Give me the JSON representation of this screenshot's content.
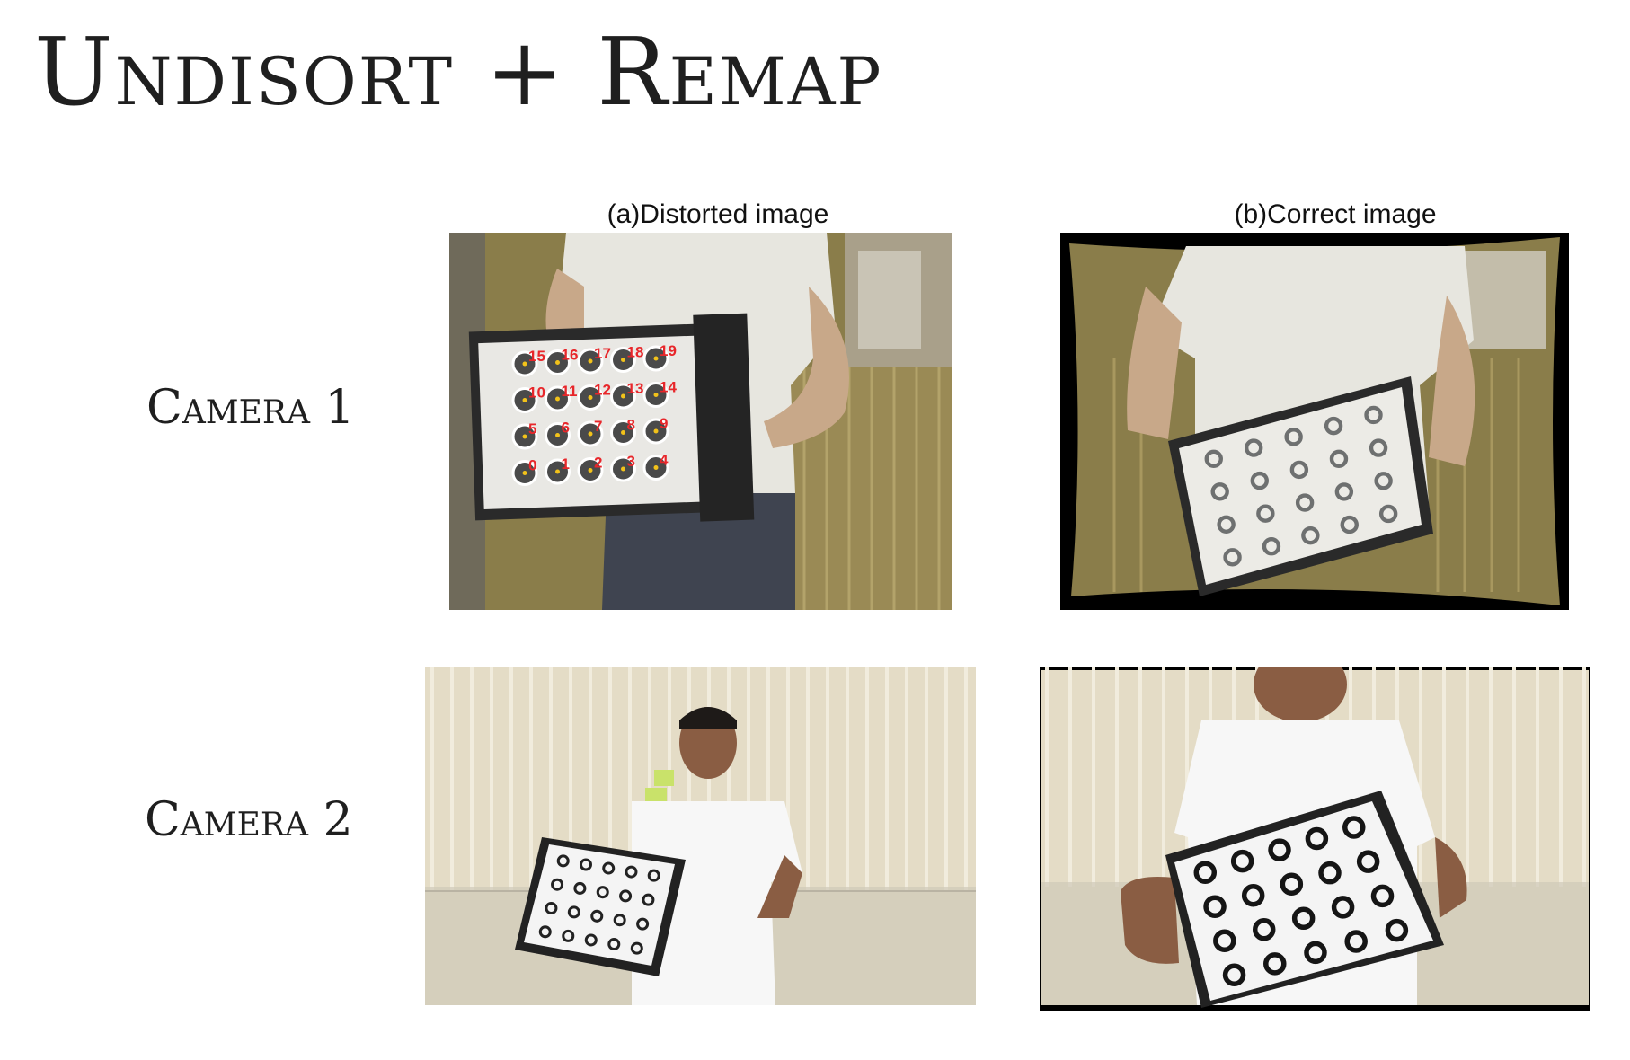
{
  "slide": {
    "title": "Undisort + Remap"
  },
  "columns": {
    "distorted": "(a)Distorted image",
    "corrected": "(b)Correct image"
  },
  "rows": [
    {
      "label": "Camera 1"
    },
    {
      "label": "Camera 2"
    }
  ],
  "detection_labels": [
    "15",
    "16",
    "17",
    "18",
    "19",
    "10",
    "11",
    "12",
    "13",
    "14",
    "5",
    "6",
    "7",
    "8",
    "9",
    "0",
    "1",
    "2",
    "3",
    "4"
  ],
  "colors": {
    "detection_circle": "#ffffff",
    "detection_number": "#e8262a",
    "wall_camera1": "#8a7d4a",
    "wall_camera2": "#e4dcc6",
    "board": "#f2f2f2"
  }
}
